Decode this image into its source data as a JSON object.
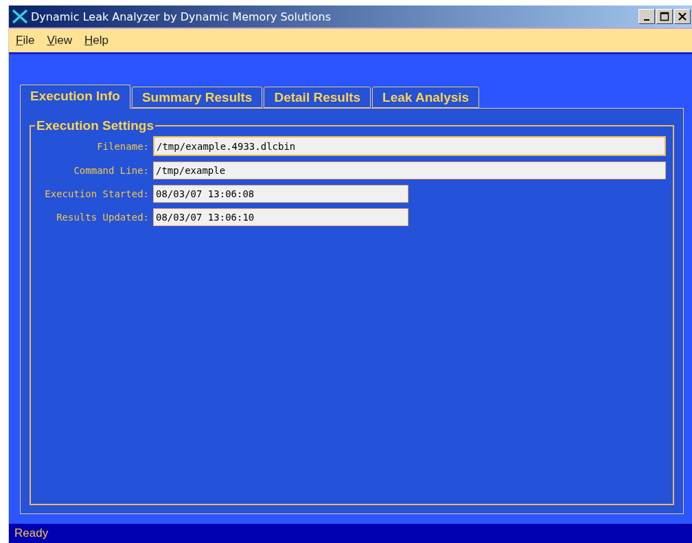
{
  "window": {
    "title": "Dynamic Leak Analyzer by Dynamic Memory Solutions"
  },
  "menu": [
    "File",
    "View",
    "Help"
  ],
  "tabs": [
    {
      "label": "Execution Info",
      "selected": true
    },
    {
      "label": "Summary Results",
      "selected": false
    },
    {
      "label": "Detail Results",
      "selected": false
    },
    {
      "label": "Leak Analysis",
      "selected": false
    }
  ],
  "group": {
    "title": "Execution Settings",
    "fields": [
      {
        "label": "Filename:",
        "value": "/tmp/example.4933.dlcbin",
        "kind": "wide",
        "focused": true
      },
      {
        "label": "Command Line:",
        "value": "/tmp/example",
        "kind": "wide",
        "focused": false
      },
      {
        "label": "Execution Started:",
        "value": "08/03/07 13:06:08",
        "kind": "short",
        "focused": false
      },
      {
        "label": "Results Updated:",
        "value": "08/03/07 13:06:10",
        "kind": "short",
        "focused": false
      }
    ]
  },
  "status_bar": "Ready"
}
